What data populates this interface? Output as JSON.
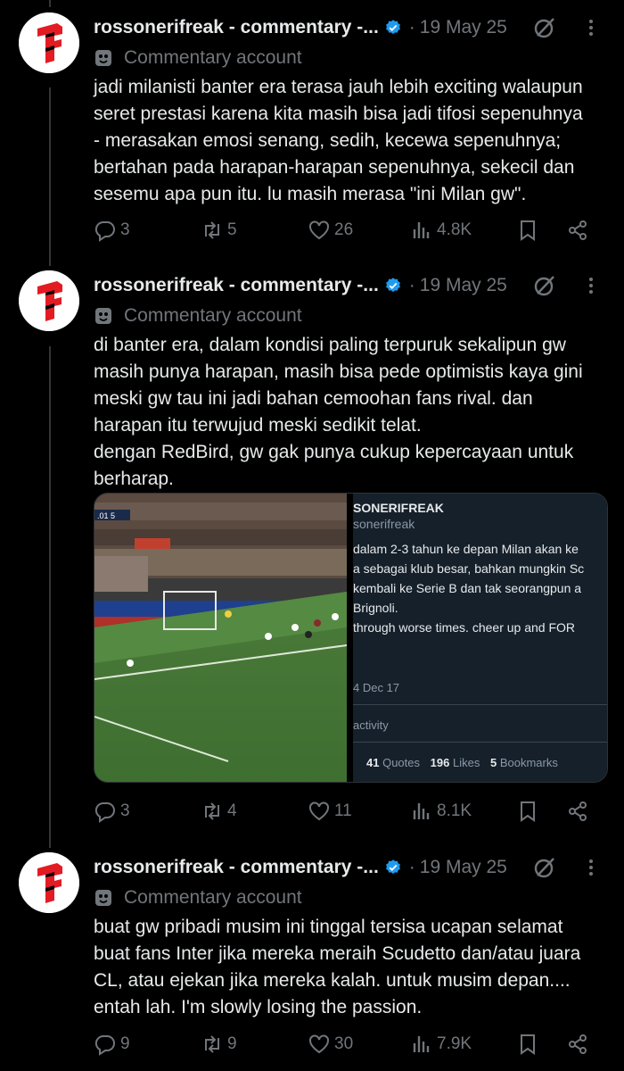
{
  "tweets": [
    {
      "author": "rossonerifreak - commentary -...",
      "date": "19 May 25",
      "account_label": "Commentary account",
      "text": "jadi milanisti banter era terasa jauh lebih exciting walaupun\nseret prestasi karena kita masih bisa jadi tifosi sepenuhnya\n- merasakan emosi senang, sedih, kecewa sepenuhnya;\nbertahan pada harapan-harapan sepenuhnya, sekecil dan\nsesemu apa pun itu. lu masih merasa \"ini Milan gw\".",
      "replies": "3",
      "reposts": "5",
      "likes": "26",
      "views": "4.8K"
    },
    {
      "author": "rossonerifreak - commentary -...",
      "date": "19 May 25",
      "account_label": "Commentary account",
      "text": "di banter era, dalam kondisi paling terpuruk sekalipun gw\nmasih punya harapan, masih bisa pede optimistis kaya gini\nmeski gw tau ini jadi bahan cemoohan fans rival. dan\nharapan itu terwujud meski sedikit telat.\ndengan RedBird, gw gak punya cukup kepercayaan untuk\nberharap.",
      "replies": "3",
      "reposts": "4",
      "likes": "11",
      "views": "8.1K",
      "media": {
        "quote_name": "SONERIFREAK",
        "quote_handle": "sonerifreak",
        "quote_lines": [
          " dalam 2-3 tahun ke depan Milan akan ke",
          "a sebagai klub besar, bahkan mungkin Sc",
          "kembali ke Serie B dan tak seorangpun a",
          "Brignoli.",
          " through worse times. cheer up and FOR"
        ],
        "quote_date": "4 Dec 17",
        "quote_activity": "activity",
        "quote_stats": [
          {
            "num": "41",
            "label": "Quotes"
          },
          {
            "num": "196",
            "label": "Likes"
          },
          {
            "num": "5",
            "label": "Bookmarks"
          }
        ],
        "video_scoreboard": ".01 5"
      }
    },
    {
      "author": "rossonerifreak - commentary -...",
      "date": "19 May 25",
      "account_label": "Commentary account",
      "text": "buat gw pribadi musim ini tinggal tersisa ucapan selamat\nbuat fans Inter jika mereka meraih Scudetto dan/atau juara\nCL, atau ejekan jika mereka kalah. untuk musim depan....\nentah lah. I'm slowly losing the passion.",
      "replies": "9",
      "reposts": "9",
      "likes": "30",
      "views": "7.9K"
    }
  ],
  "colors": {
    "background": "#000000",
    "text": "#e7e9ea",
    "muted": "#71767b",
    "verified": "#1d9bf0",
    "avatar_red": "#e31b23"
  }
}
